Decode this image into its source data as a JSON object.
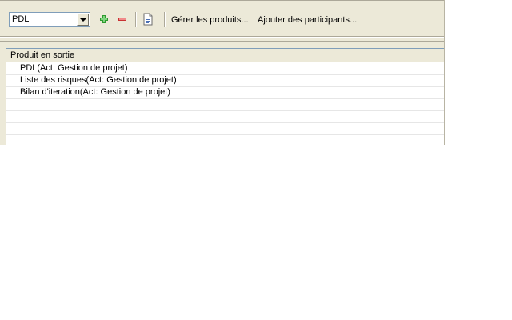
{
  "toolbar": {
    "combo_value": "PDL",
    "add_icon": "plus-icon",
    "remove_icon": "minus-icon",
    "document_icon": "document-icon",
    "manage_products_label": "Gérer les produits...",
    "add_participants_label": "Ajouter des participants..."
  },
  "table": {
    "column_header": "Produit en sortie",
    "rows": [
      {
        "label": "PDL(Act: Gestion de projet)"
      },
      {
        "label": "Liste des risques(Act: Gestion de projet)"
      },
      {
        "label": "Bilan d'iteration(Act: Gestion de projet)"
      },
      {
        "label": ""
      },
      {
        "label": ""
      },
      {
        "label": ""
      },
      {
        "label": ""
      }
    ]
  },
  "colors": {
    "panel_bg": "#ece9d8",
    "add_green": "#2e9a2e",
    "remove_red": "#c83232",
    "border_blue": "#7f9db9"
  }
}
